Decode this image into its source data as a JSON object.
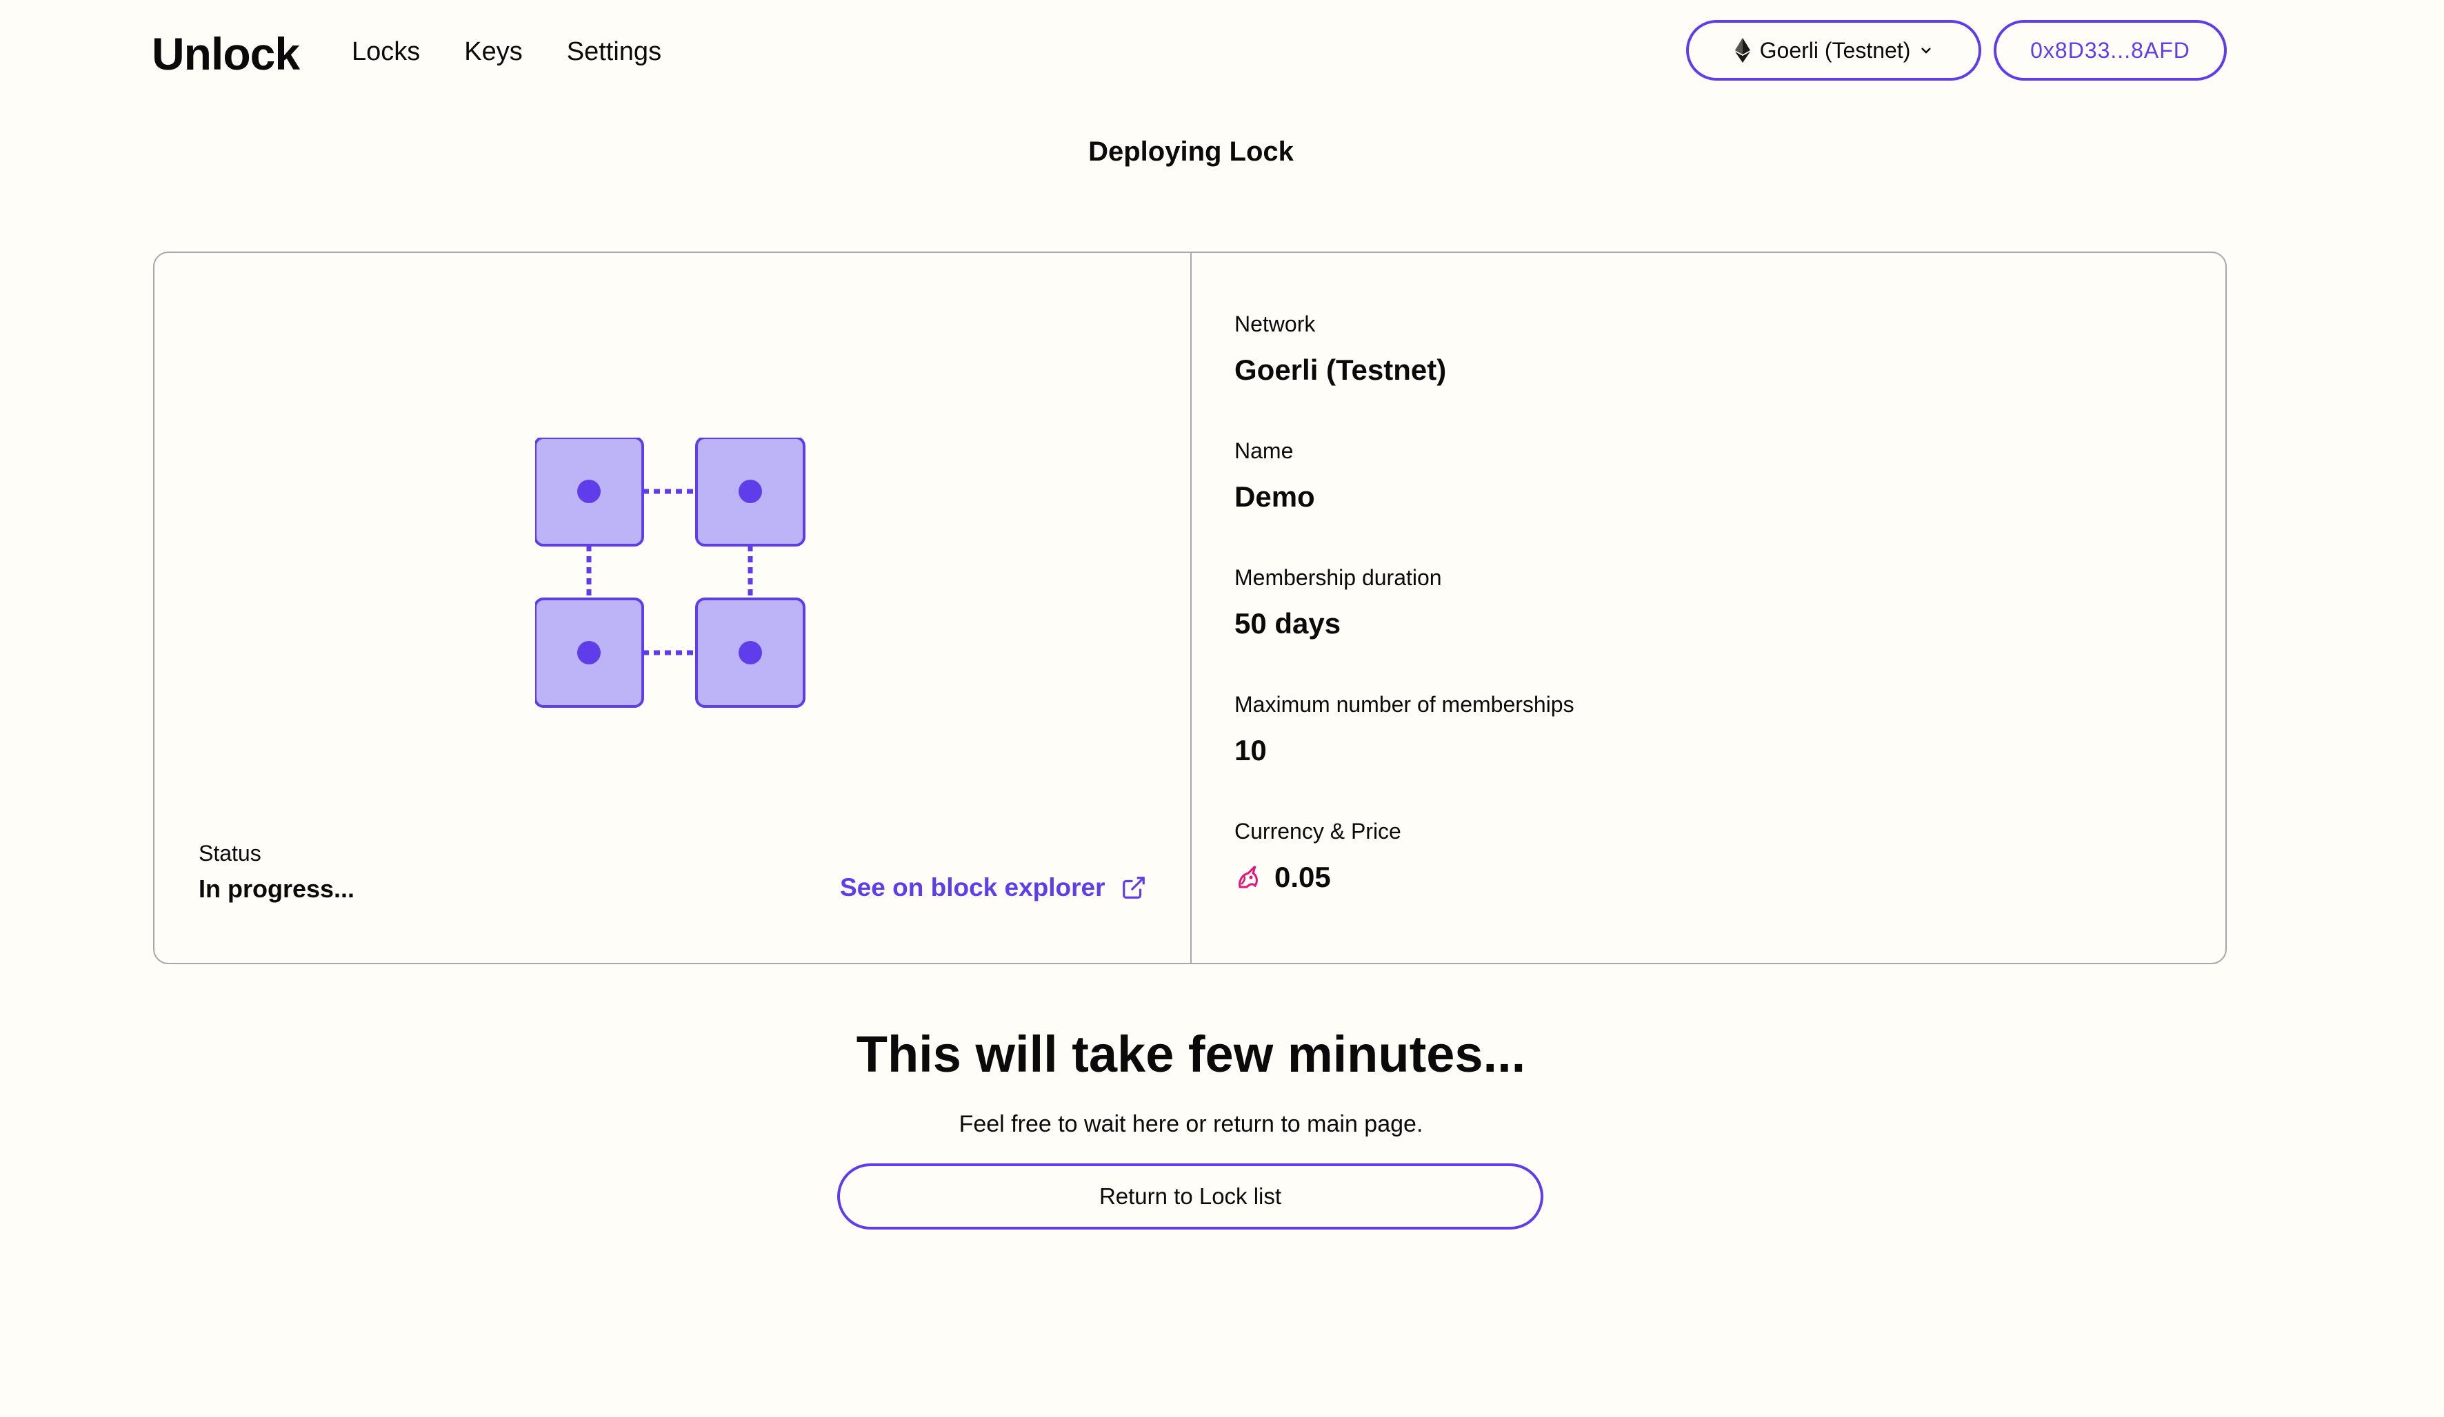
{
  "app": {
    "logo_text": "Unlock"
  },
  "nav": {
    "items": [
      "Locks",
      "Keys",
      "Settings"
    ]
  },
  "header": {
    "network_label": "Goerli (Testnet)",
    "network_icon": "ethereum-icon",
    "account_label": "0x8D33...8AFD"
  },
  "page": {
    "title": "Deploying Lock"
  },
  "status": {
    "label": "Status",
    "value": "In progress...",
    "explorer_link": "See on block explorer"
  },
  "details": [
    {
      "label": "Network",
      "value": "Goerli (Testnet)"
    },
    {
      "label": "Name",
      "value": "Demo"
    },
    {
      "label": "Membership duration",
      "value": "50 days"
    },
    {
      "label": "Maximum number of memberships",
      "value": "10"
    },
    {
      "label": "Currency & Price",
      "value": "0.05",
      "icon": "unicorn-token-icon"
    }
  ],
  "footer": {
    "headline": "This will take few minutes...",
    "subtext": "Feel free to wait here or return to main page.",
    "button_label": "Return to Lock list"
  },
  "colors": {
    "accent": "#603DEB",
    "background": "#FFFDF7",
    "block_fill": "#BDB3F7",
    "border": "#A7A7AE",
    "token": "#E0157A"
  }
}
